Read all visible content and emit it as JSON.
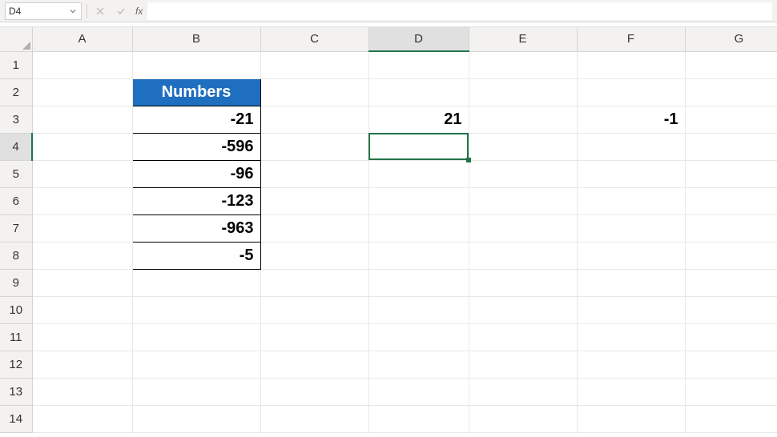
{
  "nameBox": "D4",
  "formula": "",
  "fxLabel": "fx",
  "columns": [
    "A",
    "B",
    "C",
    "D",
    "E",
    "F",
    "G"
  ],
  "rows": [
    "1",
    "2",
    "3",
    "4",
    "5",
    "6",
    "7",
    "8",
    "9",
    "10",
    "11",
    "12",
    "13",
    "14"
  ],
  "selected": {
    "col": "D",
    "row": 4,
    "ref": "D4"
  },
  "tableHeader": "Numbers",
  "cells": {
    "B2": "Numbers",
    "B3": "-21",
    "B4": "-596",
    "B5": "-96",
    "B6": "-123",
    "B7": "-963",
    "B8": "-5",
    "D3": "21",
    "F3": "-1"
  }
}
